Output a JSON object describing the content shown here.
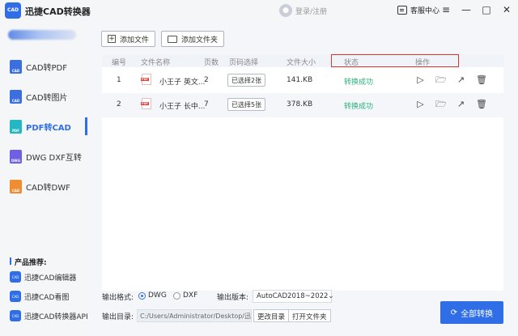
{
  "app": {
    "title": "迅捷CAD转换器",
    "logo_text": "CAD"
  },
  "header": {
    "login_text": "登录/注册",
    "service_label": "客服中心"
  },
  "window_controls": [
    "menu-icon",
    "minimize-icon",
    "maximize-icon",
    "close-icon"
  ],
  "sidebar": {
    "items": [
      {
        "label": "CAD转PDF",
        "icon": "cad-to-pdf-icon",
        "color": "#3b6fe0",
        "badge": "CAD"
      },
      {
        "label": "CAD转图片",
        "icon": "cad-to-image-icon",
        "color": "#3b6fe0",
        "badge": "CAD"
      },
      {
        "label": "PDF转CAD",
        "icon": "pdf-to-cad-icon",
        "color": "#23b6c3",
        "badge": "PDF",
        "active": true
      },
      {
        "label": "DWG DXF互转",
        "icon": "dwg-dxf-icon",
        "color": "#6e5fe3",
        "badge": "DWG"
      },
      {
        "label": "CAD转DWF",
        "icon": "cad-to-dwf-icon",
        "color": "#f08c32",
        "badge": "CAD"
      }
    ],
    "recommend_title": "产品推荐:",
    "recommend_items": [
      {
        "label": "迅捷CAD编辑器",
        "badge": "CAD"
      },
      {
        "label": "迅捷CAD看图",
        "badge": "CAD"
      },
      {
        "label": "迅捷CAD转换器APP",
        "badge": "CAD"
      }
    ]
  },
  "toolbar": {
    "add_file": "添加文件",
    "add_folder": "添加文件夹"
  },
  "table": {
    "headers": {
      "index": "编号",
      "name": "文件名称",
      "pages": "页数",
      "page_select": "页码选择",
      "size": "文件大小",
      "status": "状态",
      "actions": "操作"
    },
    "rows": [
      {
        "index": "1",
        "name": "小王子 英文...",
        "pages": "2",
        "page_select": "已选择2张",
        "size": "141.KB",
        "status": "转换成功"
      },
      {
        "index": "2",
        "name": "小王子 长中...",
        "pages": "7",
        "page_select": "已选择5张",
        "size": "378.KB",
        "status": "转换成功"
      }
    ]
  },
  "output": {
    "format_label": "输出格式:",
    "format_options": [
      "DWG",
      "DXF"
    ],
    "format_selected": "DWG",
    "version_label": "输出版本:",
    "version_value": "AutoCAD2018~2022",
    "dir_label": "输出目录:",
    "dir_value": "C:/Users/Administrator/Desktop/迅...",
    "change_dir": "更改目录",
    "open_folder": "打开文件夹",
    "convert_all": "全部转换"
  },
  "colors": {
    "accent": "#2f6ee6",
    "success": "#29b27a",
    "highlight": "#d9342b"
  }
}
